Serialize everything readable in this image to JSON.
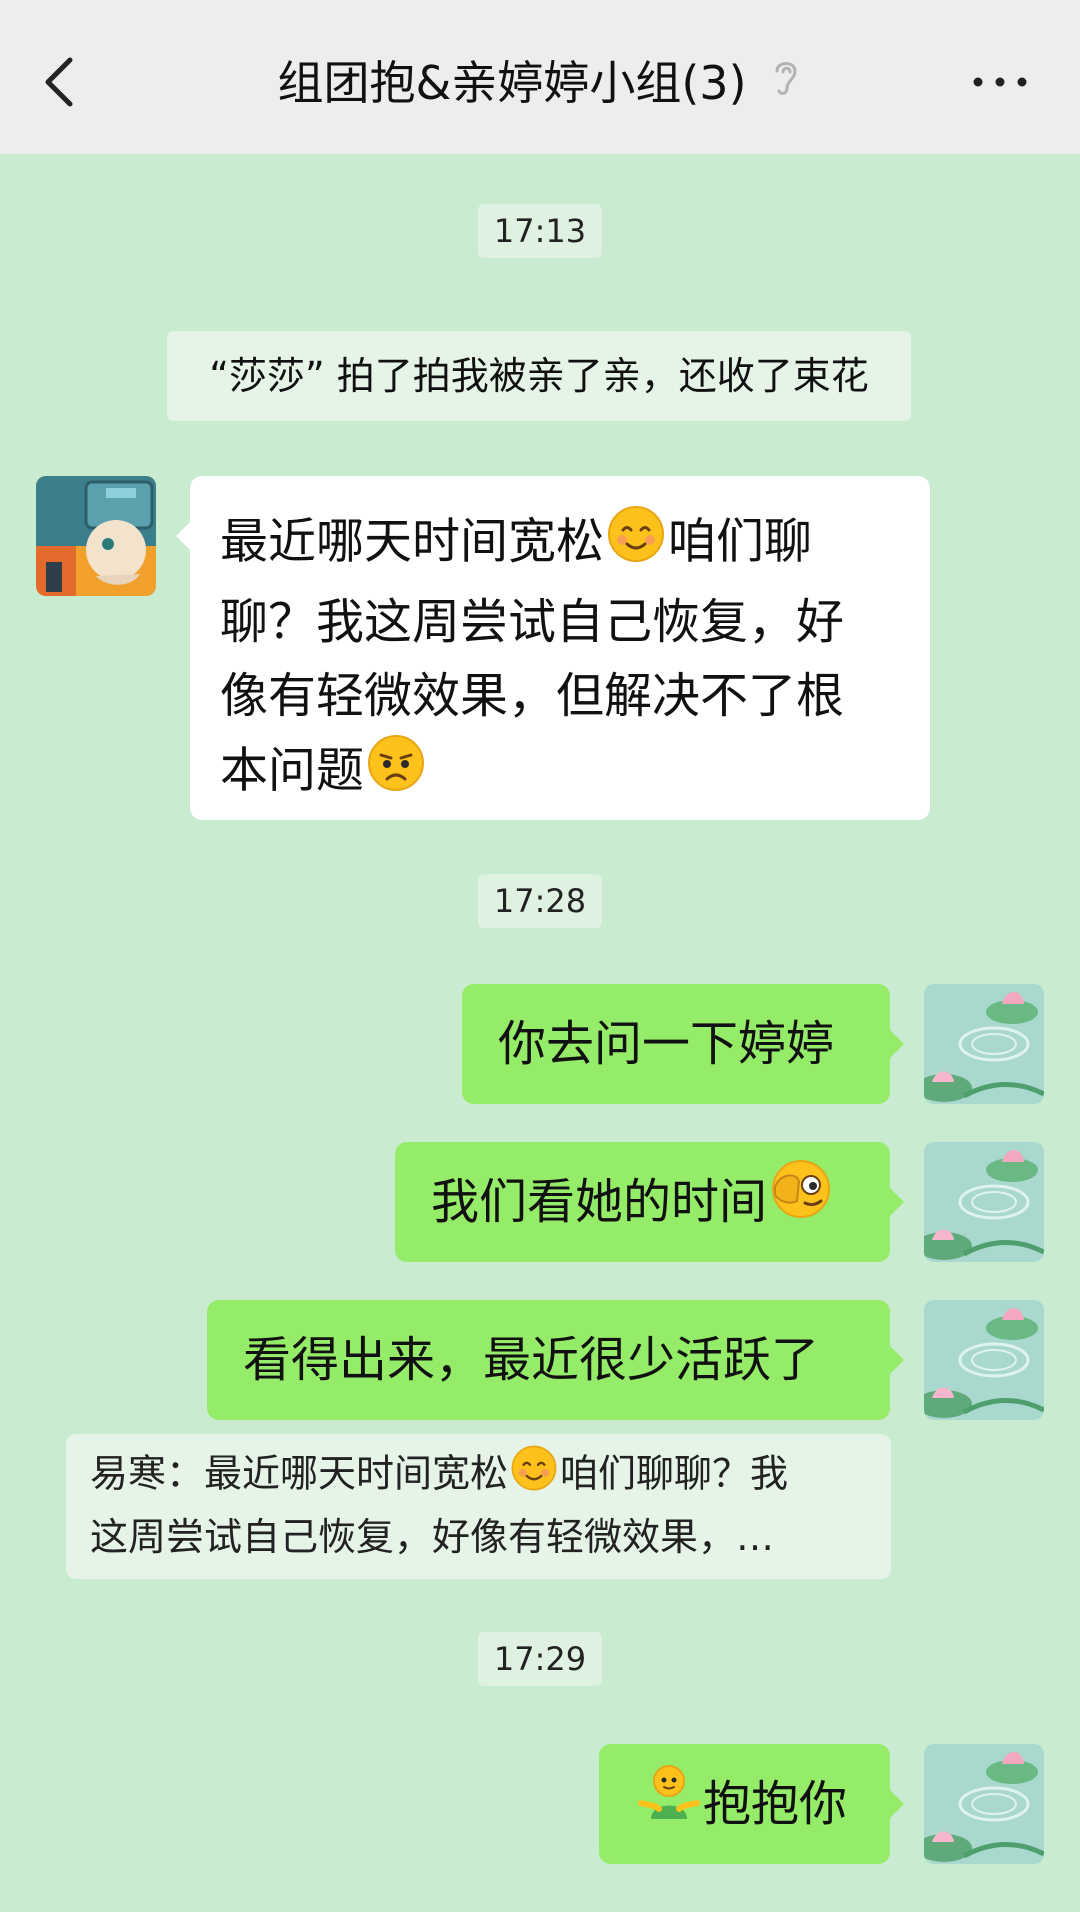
{
  "header": {
    "title": "组团抱&亲婷婷小组(3)"
  },
  "messages": {
    "time_1": "17:13",
    "system_pat": "“莎莎” 拍了拍我被亲了亲，还收了束花",
    "left_msg": {
      "part1": "最近哪天时间宽松",
      "part2": "咱们聊",
      "part3": "聊？我这周尝试自己恢复，好",
      "part4": "像有轻微效果，但解决不了根",
      "part5": "本问题"
    },
    "time_2": "17:28",
    "right_1": "你去问一下婷婷",
    "right_2": "我们看她的时间",
    "right_3": "看得出来，最近很少活跃了",
    "quote": {
      "part1": "易寒：最近哪天时间宽松",
      "part2": "咱们聊聊？我",
      "part3": "这周尝试自己恢复，好像有轻微效果，…"
    },
    "time_3": "17:29",
    "right_4": "抱抱你"
  },
  "icons": {
    "back": "chevron-left-icon",
    "ear": "ear-icon",
    "more": "more-dots-icon",
    "smile": "smiling-face-icon",
    "sad": "sad-face-icon",
    "wink": "peek-face-icon",
    "hug": "hug-figure-icon"
  },
  "colors": {
    "chat_bg": "#c9ebcf",
    "header_bg": "#ededed",
    "my_bubble": "#95ec69",
    "their_bubble": "#ffffff"
  }
}
